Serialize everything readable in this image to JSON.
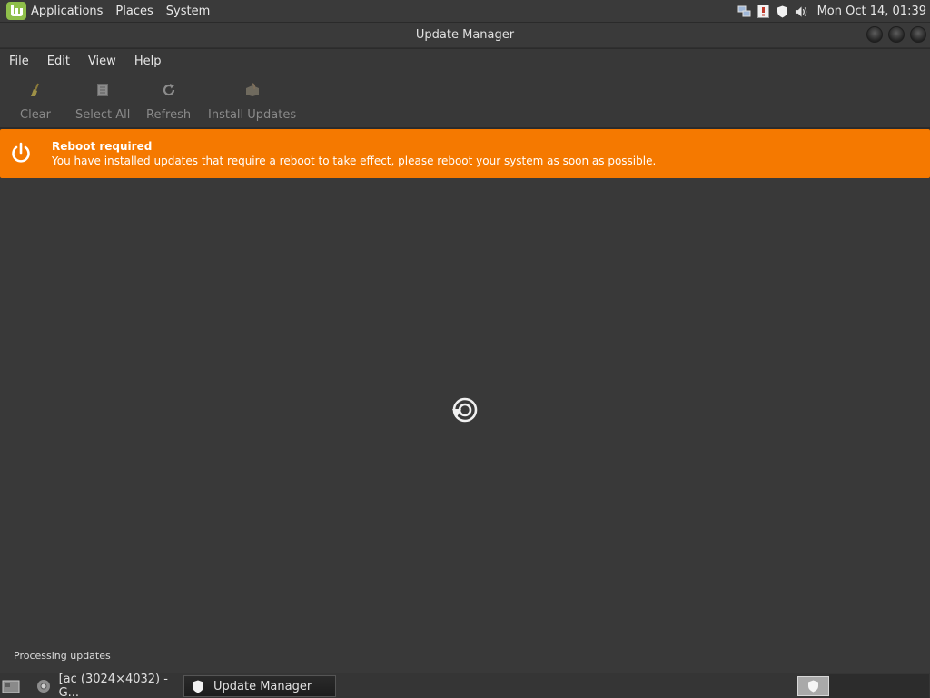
{
  "top_panel": {
    "menus": [
      "Applications",
      "Places",
      "System"
    ],
    "clock": "Mon Oct 14, 01:39",
    "tray_icons": [
      "network-icon",
      "update-warning-icon",
      "shield-icon",
      "volume-icon"
    ]
  },
  "window": {
    "title": "Update Manager"
  },
  "menubar": {
    "items": [
      "File",
      "Edit",
      "View",
      "Help"
    ]
  },
  "toolbar": {
    "clear": "Clear",
    "select_all": "Select All",
    "refresh": "Refresh",
    "install_updates": "Install Updates"
  },
  "infobar": {
    "title": "Reboot required",
    "message": "You have installed updates that require a reboot to take effect, please reboot your system as soon as possible.",
    "color": "#f57900"
  },
  "status": {
    "text": "Processing updates"
  },
  "taskbar": {
    "tasks": [
      {
        "label": "[ac (3024×4032) - G..."
      },
      {
        "label": "Update Manager"
      }
    ]
  }
}
